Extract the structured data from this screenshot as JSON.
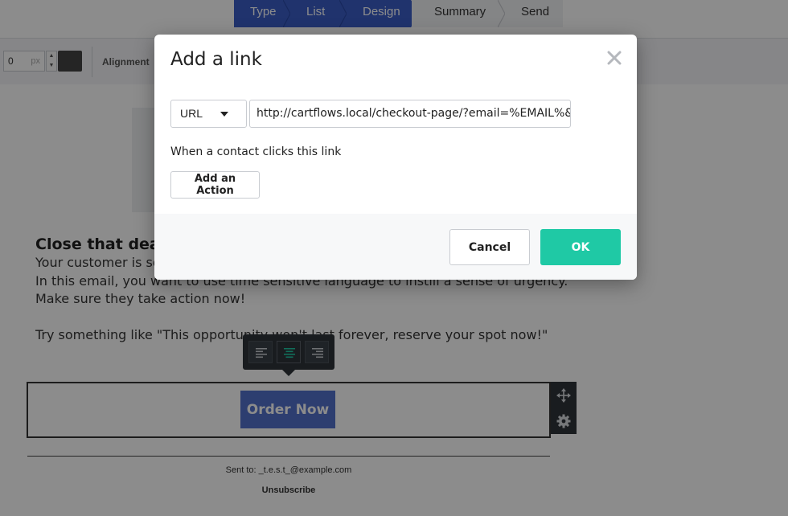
{
  "wizard": {
    "steps": [
      {
        "label": "Type",
        "state": "complete"
      },
      {
        "label": "List",
        "state": "complete"
      },
      {
        "label": "Design",
        "state": "current"
      },
      {
        "label": "Summary",
        "state": "upcoming"
      },
      {
        "label": "Send",
        "state": "upcoming"
      }
    ]
  },
  "toolbar": {
    "padding_value": "0",
    "padding_unit": "px",
    "swatch_color": "#444444",
    "alignment_label": "Alignment"
  },
  "email": {
    "heading": "Close that deal",
    "line1": "Your customer is so",
    "line2": "In this email, you want to use time sensitive language to instill a sense of urgency.",
    "line3": "Make sure they take action now!",
    "line4": "Try something like \"This opportunity won't last forever, reserve your spot now!\"",
    "alignment_options": [
      "align-left-icon",
      "align-center-icon",
      "align-right-icon"
    ],
    "alignment_selected": "center",
    "button_label": "Order Now",
    "button_color": "#3b5ec6",
    "sent_to": "Sent to: _t.e.s.t_@example.com",
    "unsubscribe": "Unsubscribe"
  },
  "modal": {
    "title": "Add a link",
    "link_type": "URL",
    "url_value": "http://cartflows.local/checkout-page/?email=%EMAIL%&fname=",
    "helper_text": "When a contact clicks this link",
    "add_action_label": "Add an Action",
    "cancel_label": "Cancel",
    "ok_label": "OK",
    "ok_color": "#1fc9a5"
  }
}
